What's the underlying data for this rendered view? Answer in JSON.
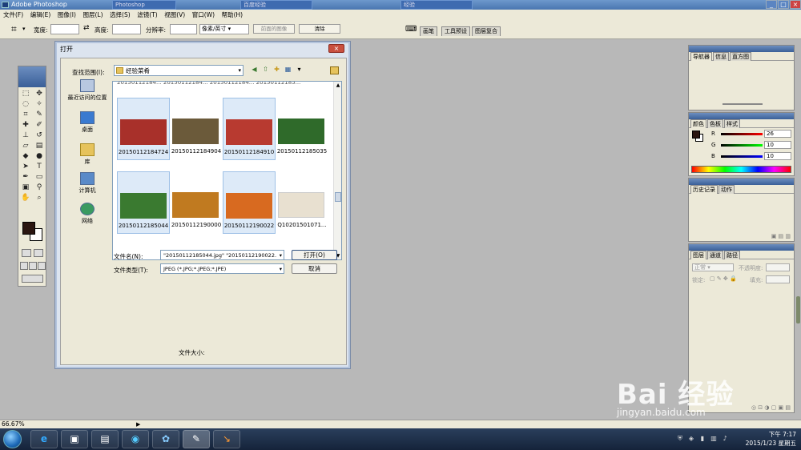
{
  "app": {
    "title": "Adobe Photoshop",
    "menu": [
      "文件(F)",
      "编辑(E)",
      "图像(I)",
      "图层(L)",
      "选择(S)",
      "滤镜(T)",
      "视图(V)",
      "窗口(W)",
      "帮助(H)"
    ],
    "task_strips": [
      "Photoshop",
      "百度经验",
      "经验"
    ]
  },
  "options_bar": {
    "width_label": "宽度:",
    "height_label": "高度:",
    "resolution_label": "分辨率:",
    "unit_select": "像素/英寸",
    "front_image_button": "前面的图像",
    "clear_button": "清除",
    "palette_tabs": [
      "画笔",
      "工具预设",
      "图层复合"
    ]
  },
  "dialog": {
    "title": "打开",
    "look_in_label": "查找范围(I):",
    "look_in_value": "经验菜肴",
    "places": [
      "最近访问的位置",
      "桌面",
      "库",
      "计算机",
      "网络"
    ],
    "cut_row_text": "20150112184... 20150112184... 20150112184... 20150112185...",
    "files": [
      {
        "name": "20150112184724",
        "selected": true,
        "tone": "#a8302a"
      },
      {
        "name": "20150112184904",
        "selected": false,
        "tone": "#6b5a3a"
      },
      {
        "name": "20150112184910",
        "selected": true,
        "tone": "#b83a30"
      },
      {
        "name": "20150112185035",
        "selected": false,
        "tone": "#2f6a2a"
      },
      {
        "name": "20150112185044",
        "selected": true,
        "tone": "#3a7a30"
      },
      {
        "name": "20150112190000",
        "selected": false,
        "tone": "#c07a20"
      },
      {
        "name": "20150112190022",
        "selected": true,
        "tone": "#d86a20"
      },
      {
        "name": "Q10201501071...",
        "selected": false,
        "tone": "#e8e0d0"
      }
    ],
    "filename_label": "文件名(N):",
    "filename_value": "\"20150112185044.jpg\" \"20150112190022.",
    "filetype_label": "文件类型(T):",
    "filetype_value": "JPEG (*.JPG;*.JPEG;*.JPE)",
    "open_button": "打开(O)",
    "cancel_button": "取消",
    "file_size_label": "文件大小:"
  },
  "panels": {
    "navigator_tabs": [
      "导航器",
      "信息",
      "直方图"
    ],
    "color_tabs": [
      "颜色",
      "色板",
      "样式"
    ],
    "color": {
      "R": "26",
      "G": "10",
      "B": "10"
    },
    "history_tabs": [
      "历史记录",
      "动作"
    ],
    "layers_tabs": [
      "图层",
      "通道",
      "路径"
    ],
    "blend_mode": "正常",
    "opacity_label": "不透明度:",
    "lock_label": "锁定:",
    "fill_label": "填充:"
  },
  "status": {
    "zoom": "66.67%"
  },
  "taskbar": {
    "time": "下午 7:17",
    "date": "2015/1/23 星期五"
  },
  "watermark": {
    "main": "Bai 经验",
    "sub": "jingyan.baidu.com"
  },
  "colors": {
    "foreground": "#2a1510",
    "accent": "#3a5f98"
  }
}
